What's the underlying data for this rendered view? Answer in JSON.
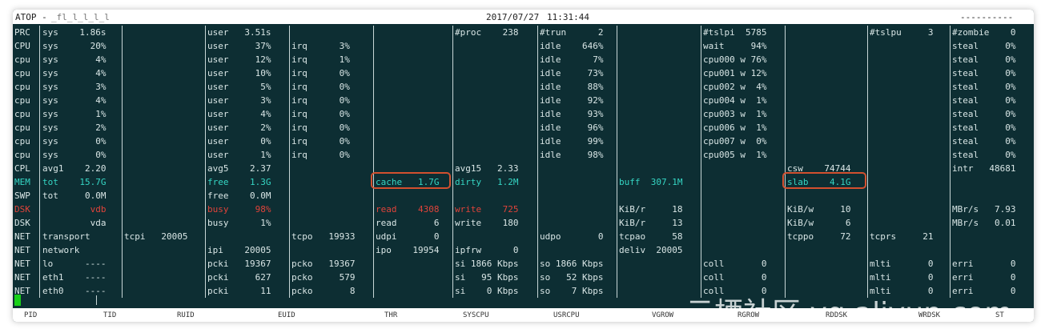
{
  "header": {
    "app": "ATOP -",
    "host": "_fl_l_l_l_l",
    "date": "2017/07/27",
    "time": "11:31:44",
    "right": "----------"
  },
  "colors": {
    "bg": "#0d2e33",
    "text": "#d9e6e6",
    "cyan": "#35d6c4",
    "red": "#e0433a",
    "highlight": "#d2502f",
    "cursor": "#18d018"
  },
  "rows": [
    {
      "label": "PRC",
      "cells": [
        "sys    1.86s",
        "",
        "user   3.51s",
        "",
        "",
        "#proc    238",
        "#trun      2",
        "",
        "#tslpi  5785",
        "",
        "#tslpu     3",
        "#zombie    0"
      ]
    },
    {
      "label": "CPU",
      "cells": [
        "sys      20%",
        "",
        "user     37%",
        "irq      3%",
        "",
        "",
        "idle    646%",
        "",
        "wait     94%",
        "",
        "",
        "steal     0%"
      ]
    },
    {
      "label": "cpu",
      "cells": [
        "sys       4%",
        "",
        "user     12%",
        "irq      1%",
        "",
        "",
        "idle      7%",
        "",
        "cpu000 w 76%",
        "",
        "",
        "steal     0%"
      ]
    },
    {
      "label": "cpu",
      "cells": [
        "sys       4%",
        "",
        "user     10%",
        "irq      0%",
        "",
        "",
        "idle     73%",
        "",
        "cpu001 w 12%",
        "",
        "",
        "steal     0%"
      ]
    },
    {
      "label": "cpu",
      "cells": [
        "sys       3%",
        "",
        "user      5%",
        "irq      0%",
        "",
        "",
        "idle     88%",
        "",
        "cpu002 w  4%",
        "",
        "",
        "steal     0%"
      ]
    },
    {
      "label": "cpu",
      "cells": [
        "sys       4%",
        "",
        "user      3%",
        "irq      0%",
        "",
        "",
        "idle     92%",
        "",
        "cpu004 w  1%",
        "",
        "",
        "steal     0%"
      ]
    },
    {
      "label": "cpu",
      "cells": [
        "sys       1%",
        "",
        "user      4%",
        "irq      0%",
        "",
        "",
        "idle     93%",
        "",
        "cpu003 w  1%",
        "",
        "",
        "steal     0%"
      ]
    },
    {
      "label": "cpu",
      "cells": [
        "sys       2%",
        "",
        "user      2%",
        "irq      0%",
        "",
        "",
        "idle     96%",
        "",
        "cpu006 w  1%",
        "",
        "",
        "steal     0%"
      ]
    },
    {
      "label": "cpu",
      "cells": [
        "sys       0%",
        "",
        "user      0%",
        "irq      0%",
        "",
        "",
        "idle     99%",
        "",
        "cpu007 w  0%",
        "",
        "",
        "steal     0%"
      ]
    },
    {
      "label": "cpu",
      "cells": [
        "sys       0%",
        "",
        "user      1%",
        "irq      0%",
        "",
        "",
        "idle     98%",
        "",
        "cpu005 w  1%",
        "",
        "",
        "steal     0%"
      ]
    },
    {
      "label": "CPL",
      "cells": [
        "avg1    2.20",
        "",
        "avg5    2.37",
        "",
        "",
        "avg15   2.33",
        "",
        "",
        "",
        "csw    74744",
        "",
        "intr   48681"
      ]
    },
    {
      "label": "MEM",
      "cells": [
        "tot    15.7G",
        "",
        "free    1.3G",
        "",
        "cache   1.7G",
        "dirty   1.2M",
        "",
        "buff  307.1M",
        "",
        "slab    4.1G",
        "",
        ""
      ]
    },
    {
      "label": "SWP",
      "cells": [
        "tot     0.0M",
        "",
        "free    0.0M",
        "",
        "",
        "",
        "",
        "",
        "",
        "",
        "",
        ""
      ]
    },
    {
      "label": "DSK",
      "cells": [
        "         vdb",
        "",
        "busy     98%",
        "",
        "read    4308",
        "write    725",
        "",
        "KiB/r     18",
        "",
        "KiB/w     10",
        "",
        "MBr/s   7.93"
      ]
    },
    {
      "label": "DSK",
      "cells": [
        "         vda",
        "",
        "busy      1%",
        "",
        "read       6",
        "write    180",
        "",
        "KiB/r     13",
        "",
        "KiB/w      6",
        "",
        "MBr/s   0.01"
      ]
    },
    {
      "label": "NET",
      "cells": [
        "transport",
        "tcpi   20005",
        "",
        "tcpo   19933",
        "udpi       0",
        "",
        "udpo       0",
        "tcpao     58",
        "",
        "tcppo     72",
        "tcprs     21",
        ""
      ]
    },
    {
      "label": "NET",
      "cells": [
        "network",
        "",
        "ipi    20005",
        "",
        "ipo    19954",
        "ipfrw      0",
        "",
        "deliv  20005",
        "",
        "",
        "",
        ""
      ]
    },
    {
      "label": "NET",
      "cells": [
        "lo      ----",
        "",
        "pcki   19367",
        "pcko   19367",
        "",
        "si 1866 Kbps",
        "so 1866 Kbps",
        "",
        "coll       0",
        "",
        "mlti       0",
        "erri       0"
      ]
    },
    {
      "label": "NET",
      "cells": [
        "eth1    ----",
        "",
        "pcki     627",
        "pcko     579",
        "",
        "si   95 Kbps",
        "so   52 Kbps",
        "",
        "coll       0",
        "",
        "mlti       0",
        "erri       0"
      ]
    },
    {
      "label": "NET",
      "cells": [
        "eth0    ----",
        "",
        "pcki      11",
        "pcko       8",
        "",
        "si    0 Kbps",
        "so    7 Kbps",
        "",
        "coll       0",
        "",
        "mlti       0",
        "erri       0"
      ]
    }
  ],
  "footer": [
    "PID",
    "TID",
    "RUID",
    "EUID",
    "THR",
    "SYSCPU",
    "USRCPU",
    "VGROW",
    "RGROW",
    "RDDSK",
    "WRDSK",
    "ST"
  ],
  "watermark": "云栖社区 yq.aliyun.com"
}
